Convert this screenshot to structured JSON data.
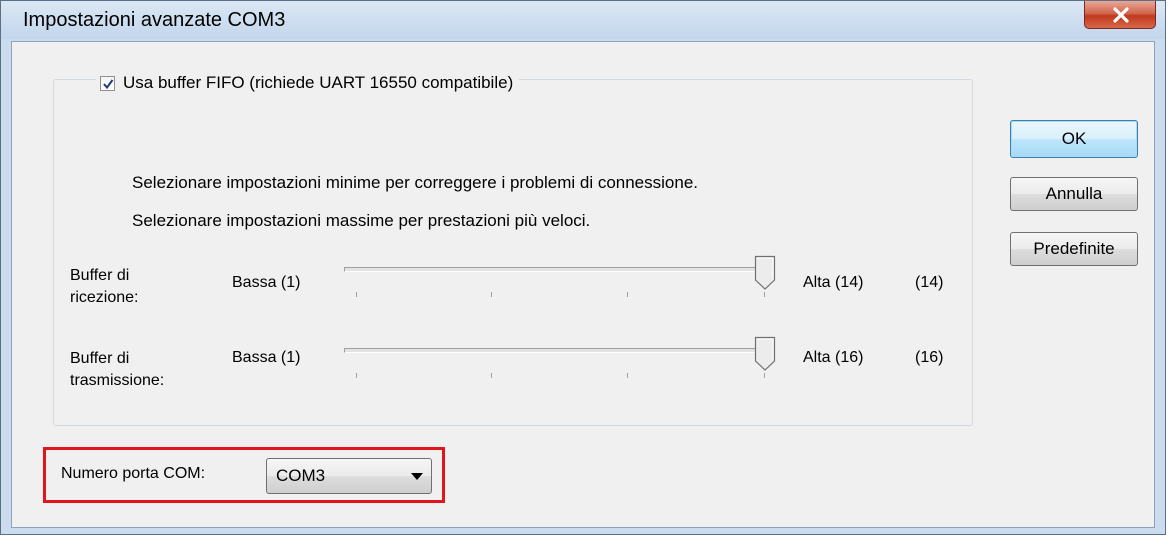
{
  "window": {
    "title": "Impostazioni avanzate COM3",
    "close_icon": "close-x-icon"
  },
  "fifo": {
    "checkbox_label": "Usa buffer FIFO (richiede UART 16550 compatibile)",
    "checked": true
  },
  "descriptions": {
    "line1": "Selezionare impostazioni minime per correggere i problemi di connessione.",
    "line2": "Selezionare impostazioni massime per prestazioni più veloci."
  },
  "receive_buffer": {
    "label_line1": "Buffer di",
    "label_line2": "ricezione:",
    "min_label": "Bassa (1)",
    "max_label": "Alta (14)",
    "value_label": "(14)",
    "min": 1,
    "max": 14,
    "value": 14
  },
  "transmit_buffer": {
    "label_line1": "Buffer di",
    "label_line2": "trasmissione:",
    "min_label": "Bassa (1)",
    "max_label": "Alta (16)",
    "value_label": "(16)",
    "min": 1,
    "max": 16,
    "value": 16
  },
  "buttons": {
    "ok": "OK",
    "cancel": "Annulla",
    "defaults": "Predefinite"
  },
  "com_port": {
    "label": "Numero porta COM:",
    "selected": "COM3"
  },
  "colors": {
    "highlight": "#e0161d",
    "close_button": "#c0391e"
  }
}
